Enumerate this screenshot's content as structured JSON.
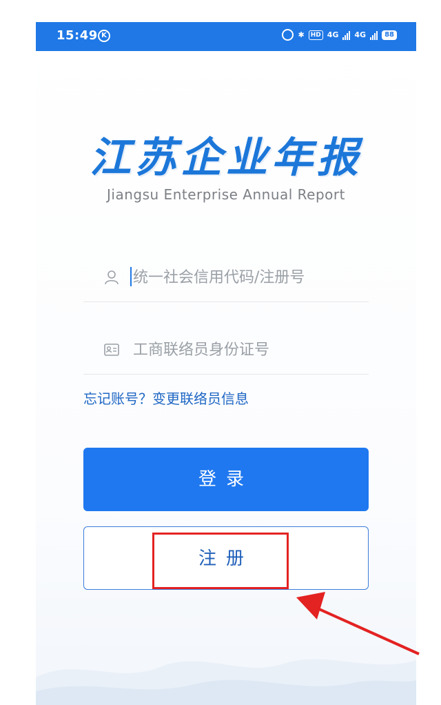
{
  "status_bar": {
    "time": "15:49",
    "k_badge": "K",
    "hd_label": "HD",
    "net1": "4G",
    "net2": "4G",
    "battery": "88"
  },
  "app": {
    "logo_text": "江苏企业年报",
    "subtitle": "Jiangsu Enterprise Annual Report"
  },
  "form": {
    "credit_code_placeholder": "统一社会信用代码/注册号",
    "id_number_placeholder": "工商联络员身份证号",
    "forgot_account": "忘记账号？",
    "change_contact": "变更联络员信息",
    "login_label": "登录",
    "register_label": "注册"
  },
  "colors": {
    "accent": "#1f78f0",
    "status_bar": "#1f78e6",
    "highlight": "#e32222"
  }
}
